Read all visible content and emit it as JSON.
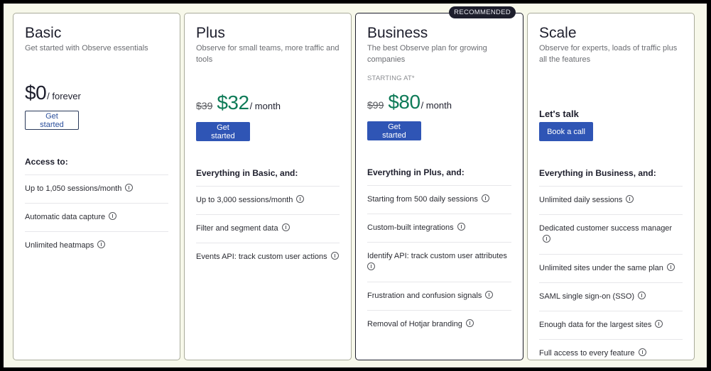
{
  "plans": [
    {
      "name": "Basic",
      "description": "Get started with Observe essentials",
      "price": "$0",
      "period": "/ forever",
      "button_label": "Get started",
      "features_title": "Access to:",
      "features": [
        "Up to 1,050 sessions/month",
        "Automatic data capture",
        "Unlimited heatmaps"
      ]
    },
    {
      "name": "Plus",
      "description": "Observe for small teams, more traffic and tools",
      "old_price": "$39",
      "price": "$32",
      "period": "/ month",
      "button_label": "Get started",
      "features_title": "Everything in Basic, and:",
      "features": [
        "Up to 3,000 sessions/month",
        "Filter and segment data",
        "Events API: track custom user actions"
      ]
    },
    {
      "name": "Business",
      "badge": "RECOMMENDED",
      "description": "The best Observe plan for growing companies",
      "starting_label": "STARTING AT*",
      "old_price": "$99",
      "price": "$80",
      "period": "/ month",
      "button_label": "Get started",
      "features_title": "Everything in Plus, and:",
      "features": [
        "Starting from 500 daily sessions",
        "Custom-built integrations",
        "Identify API: track custom user attributes",
        "Frustration and confusion signals",
        "Removal of Hotjar branding"
      ]
    },
    {
      "name": "Scale",
      "description": "Observe for experts, loads of traffic plus all the features",
      "talk_label": "Let's talk",
      "button_label": "Book a call",
      "features_title": "Everything in Business, and:",
      "features": [
        "Unlimited daily sessions",
        "Dedicated customer success manager",
        "Unlimited sites under the same plan",
        "SAML single sign-on (SSO)",
        "Enough data for the largest sites",
        "Full access to every feature"
      ]
    }
  ],
  "colors": {
    "accent_button": "#2f55b5",
    "price_green": "#0f7b58",
    "page_bg": "#f7f8ea",
    "badge_bg": "#1d1e2c"
  }
}
